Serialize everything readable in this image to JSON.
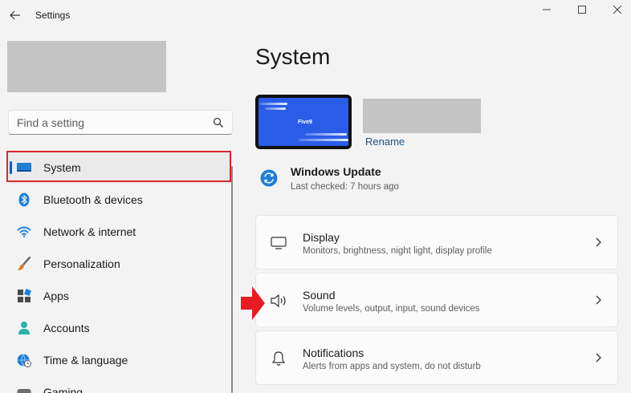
{
  "window": {
    "title": "Settings"
  },
  "sidebar": {
    "search_placeholder": "Find a setting",
    "items": [
      {
        "label": "System",
        "icon": "system-icon"
      },
      {
        "label": "Bluetooth & devices",
        "icon": "bluetooth-icon"
      },
      {
        "label": "Network & internet",
        "icon": "wifi-icon"
      },
      {
        "label": "Personalization",
        "icon": "brush-icon"
      },
      {
        "label": "Apps",
        "icon": "apps-icon"
      },
      {
        "label": "Accounts",
        "icon": "account-icon"
      },
      {
        "label": "Time & language",
        "icon": "globe-clock-icon"
      },
      {
        "label": "Gaming",
        "icon": "gaming-icon"
      }
    ],
    "selected_index": 0
  },
  "main": {
    "title": "System",
    "device": {
      "thumbnail_text": "Five9",
      "rename_label": "Rename"
    },
    "update": {
      "title": "Windows Update",
      "subtitle": "Last checked: 7 hours ago"
    },
    "cards": [
      {
        "title": "Display",
        "subtitle": "Monitors, brightness, night light, display profile",
        "icon": "monitor-icon"
      },
      {
        "title": "Sound",
        "subtitle": "Volume levels, output, input, sound devices",
        "icon": "speaker-icon"
      },
      {
        "title": "Notifications",
        "subtitle": "Alerts from apps and system, do not disturb",
        "icon": "bell-icon"
      }
    ]
  },
  "colors": {
    "accent": "#005fb8",
    "highlight_red": "#d9252c",
    "thumbnail_blue": "#2b5ce8",
    "placeholder_gray": "#c4c4c4"
  }
}
